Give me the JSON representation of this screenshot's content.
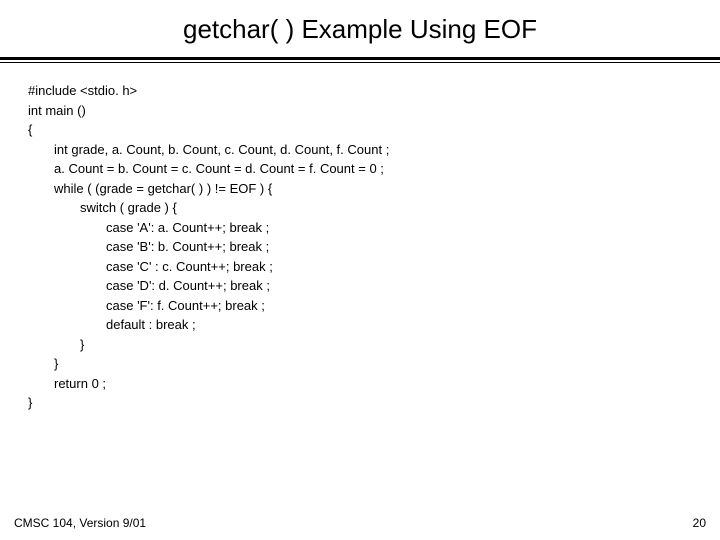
{
  "title": "getchar( ) Example Using EOF",
  "code": {
    "l0": "#include <stdio. h>",
    "l1": "int main ()",
    "l2": "{",
    "l3": "int grade, a. Count, b. Count, c. Count, d. Count, f. Count ;",
    "l4": "a. Count = b. Count = c. Count = d. Count = f. Count = 0 ;",
    "l5": "while (  (grade = getchar( ) )  !=  EOF ) {",
    "l6": "switch ( grade ) {",
    "l7": "case 'A':  a. Count++;  break ;",
    "l8": "case 'B':  b. Count++;  break ;",
    "l9": "case 'C' :  c. Count++;  break ;",
    "l10": "case 'D':  d. Count++; break ;",
    "l11": "case 'F':  f. Count++;  break ;",
    "l12": "default :  break ;",
    "l13": "}",
    "l14": "}",
    "l15": "return 0 ;",
    "l16": "}"
  },
  "footer": {
    "left": "CMSC 104, Version 9/01",
    "right": "20"
  }
}
